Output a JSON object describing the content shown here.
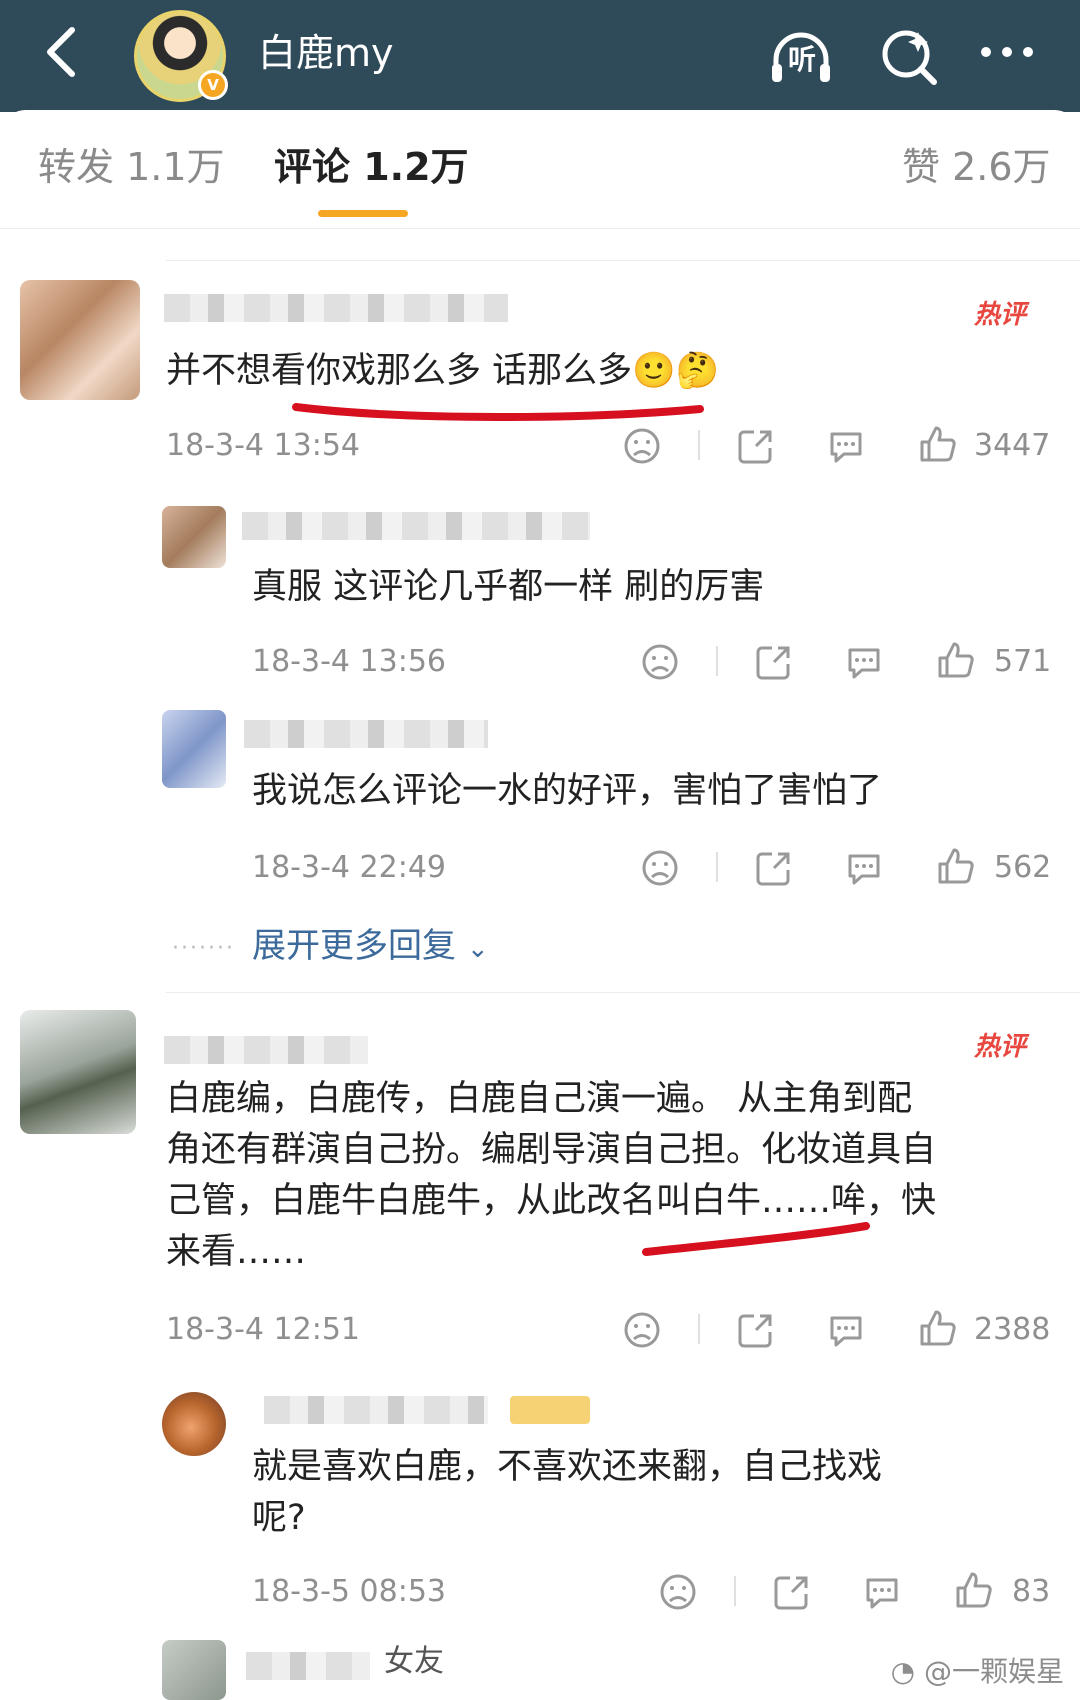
{
  "header": {
    "account_name": "白鹿my",
    "verified_badge": "V",
    "listen_label": "听",
    "icons": [
      "back-arrow-icon",
      "listen-headphones-icon",
      "search-icon",
      "more-icon"
    ]
  },
  "tabs": [
    {
      "label": "转发 1.1万"
    },
    {
      "label": "评论 1.2万"
    },
    {
      "label": "赞 2.6万"
    }
  ],
  "accent_colors": {
    "header_bg": "#2f4a59",
    "tab_underline": "#f5a623",
    "hot_tag": "#e8473f",
    "link": "#3c6a9b",
    "annotation": "#d6101e"
  },
  "comments": [
    {
      "hot_tag": "热评",
      "text": "并不想看你戏那么多 话那么多",
      "emoji": "🙂🤔",
      "time": "18-3-4 13:54",
      "likes": "3447",
      "replies": [
        {
          "text": "真服 这评论几乎都一样 刷的厉害",
          "time": "18-3-4 13:56",
          "likes": "571"
        },
        {
          "text": "我说怎么评论一水的好评，害怕了害怕了",
          "time": "18-3-4 22:49",
          "likes": "562"
        }
      ],
      "expand_more": "展开更多回复"
    },
    {
      "hot_tag": "热评",
      "text_lines": [
        "白鹿编，白鹿传，白鹿自己演一遍。 从主角到配",
        "角还有群演自己扮。编剧导演自己担。化妆道具自",
        "己管，白鹿牛白鹿牛，从此改名叫白牛……哞，快",
        "来看……"
      ],
      "time": "18-3-4 12:51",
      "likes": "2388",
      "replies": [
        {
          "text_lines": [
            "就是喜欢白鹿，不喜欢还来翻，自己找戏",
            "呢?"
          ],
          "time": "18-3-5 08:53",
          "likes": "83"
        },
        {
          "partial_name": "女友"
        }
      ]
    }
  ],
  "watermark": "@一颗娱星"
}
